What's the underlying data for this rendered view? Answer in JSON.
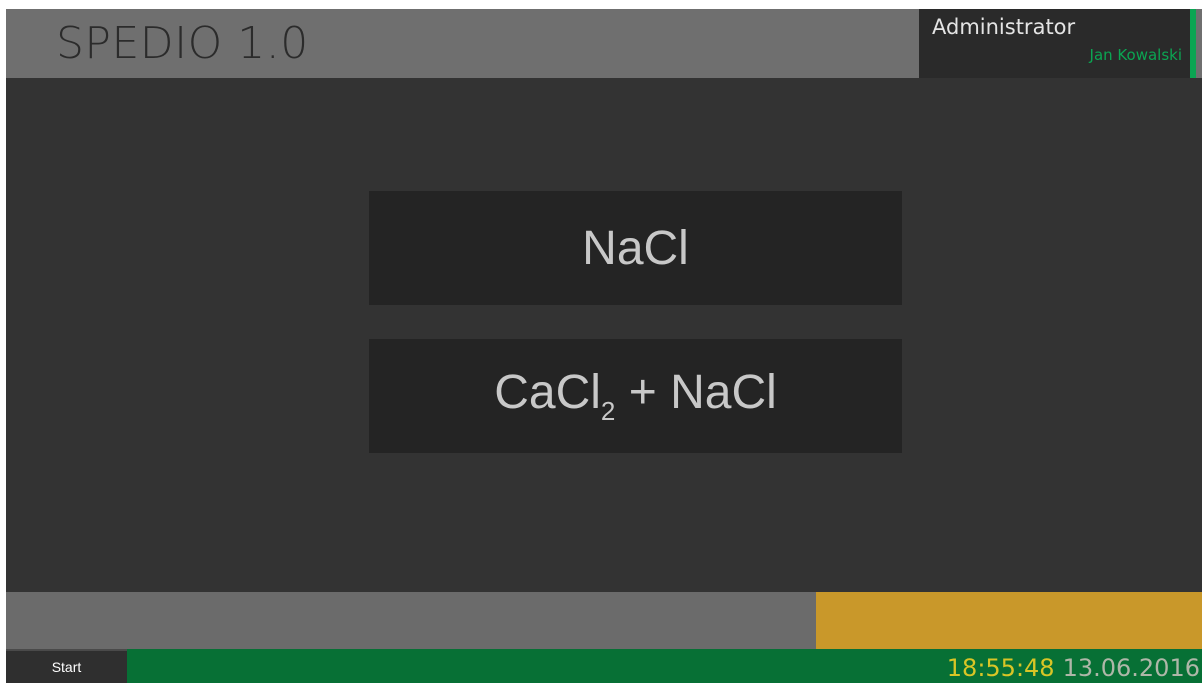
{
  "header": {
    "app_title": "SPEDIO 1.0",
    "user_role": "Administrator",
    "user_name": "Jan Kowalski"
  },
  "options": [
    {
      "formula_main": "NaCl",
      "formula_sub": "",
      "formula_tail": ""
    },
    {
      "formula_main": "CaCl",
      "formula_sub": "2",
      "formula_tail": " + NaCl"
    }
  ],
  "taskbar": {
    "start_label": "Start",
    "time": "18:55:48",
    "date": "13.06.2016"
  },
  "colors": {
    "accent_green": "#0ba552",
    "taskbar_green": "#077035",
    "progress_gold": "#c9982a",
    "clock_yellow": "#d8c526"
  }
}
